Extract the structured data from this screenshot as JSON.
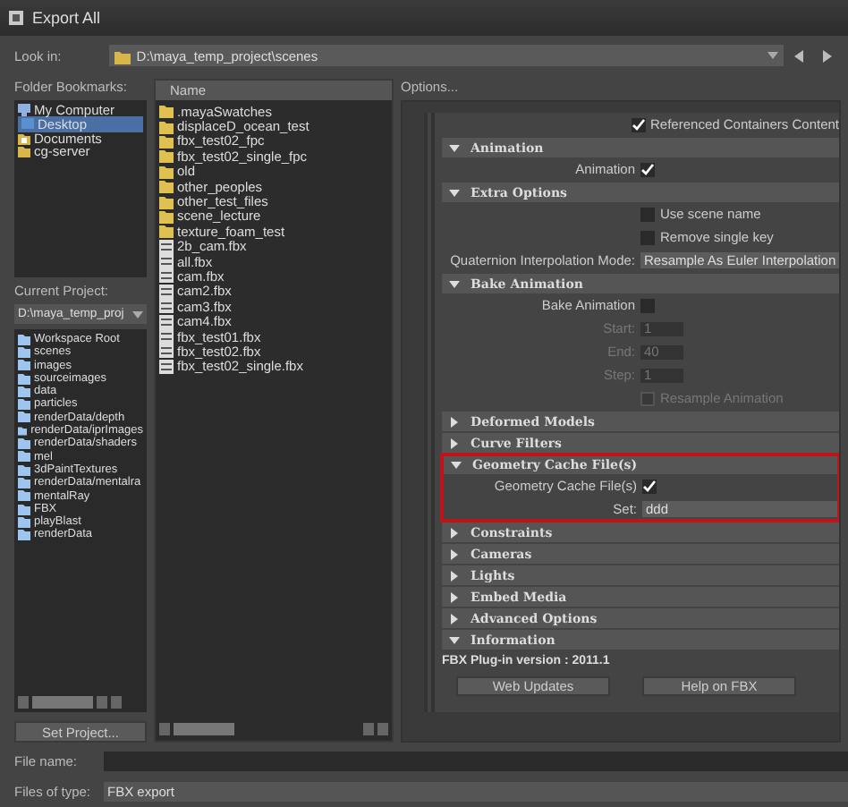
{
  "window": {
    "title": "Export All"
  },
  "look_in": {
    "label": "Look in:",
    "value": "D:\\maya_temp_project\\scenes"
  },
  "bookmarks": {
    "label": "Folder Bookmarks:",
    "items": [
      {
        "label": "My Computer",
        "kind": "computer",
        "selected": false
      },
      {
        "label": "Desktop",
        "kind": "desktop",
        "selected": true
      },
      {
        "label": "Documents",
        "kind": "documents",
        "selected": false
      },
      {
        "label": "cg-server",
        "kind": "folder",
        "selected": false
      }
    ]
  },
  "current_project": {
    "label": "Current Project:",
    "value": "D:\\maya_temp_proj",
    "items": [
      "Workspace Root",
      "scenes",
      "images",
      "sourceimages",
      "data",
      "particles",
      "renderData/depth",
      "renderData/iprImages",
      "renderData/shaders",
      "mel",
      "3dPaintTextures",
      "renderData/mentalra",
      "mentalRay",
      "FBX",
      "playBlast",
      "renderData"
    ],
    "button": "Set Project..."
  },
  "files": {
    "column": "Name",
    "items": [
      {
        "name": ".mayaSwatches",
        "kind": "folder"
      },
      {
        "name": "displaceD_ocean_test",
        "kind": "folder"
      },
      {
        "name": "fbx_test02_fpc",
        "kind": "folder"
      },
      {
        "name": "fbx_test02_single_fpc",
        "kind": "folder"
      },
      {
        "name": "old",
        "kind": "folder"
      },
      {
        "name": "other_peoples",
        "kind": "folder"
      },
      {
        "name": "other_test_files",
        "kind": "folder"
      },
      {
        "name": "scene_lecture",
        "kind": "folder"
      },
      {
        "name": "texture_foam_test",
        "kind": "folder"
      },
      {
        "name": "2b_cam.fbx",
        "kind": "file"
      },
      {
        "name": "all.fbx",
        "kind": "file"
      },
      {
        "name": "cam.fbx",
        "kind": "file"
      },
      {
        "name": "cam2.fbx",
        "kind": "file"
      },
      {
        "name": "cam3.fbx",
        "kind": "file"
      },
      {
        "name": "cam4.fbx",
        "kind": "file"
      },
      {
        "name": "fbx_test01.fbx",
        "kind": "file"
      },
      {
        "name": "fbx_test02.fbx",
        "kind": "file"
      },
      {
        "name": "fbx_test02_single.fbx",
        "kind": "file"
      }
    ]
  },
  "options": {
    "label": "Options...",
    "rows": [
      {
        "kind": "checkbox",
        "label": "Referenced Containers Content",
        "checked": true
      },
      {
        "kind": "section",
        "label": "Animation",
        "expanded": true,
        "highlighted": false,
        "rows": [
          {
            "kind": "labeled_checkbox",
            "label": "Animation",
            "checked": true
          }
        ]
      },
      {
        "kind": "section",
        "label": "Extra Options",
        "expanded": true,
        "highlighted": false,
        "rows": [
          {
            "kind": "checkbox",
            "label": "Use scene name",
            "checked": false
          },
          {
            "kind": "checkbox",
            "label": "Remove single key",
            "checked": false
          },
          {
            "kind": "select",
            "label": "Quaternion Interpolation Mode:",
            "value": "Resample As Euler Interpolation"
          }
        ]
      },
      {
        "kind": "section",
        "label": "Bake Animation",
        "expanded": true,
        "highlighted": false,
        "rows": [
          {
            "kind": "labeled_checkbox",
            "label": "Bake Animation",
            "checked": false
          },
          {
            "kind": "field",
            "label": "Start:",
            "value": "1",
            "disabled": true
          },
          {
            "kind": "field",
            "label": "End:",
            "value": "40",
            "disabled": true
          },
          {
            "kind": "field",
            "label": "Step:",
            "value": "1",
            "disabled": true
          },
          {
            "kind": "checkbox",
            "label": "Resample Animation",
            "checked": false,
            "disabled": true
          }
        ]
      },
      {
        "kind": "section",
        "label": "Deformed Models",
        "expanded": false,
        "highlighted": false
      },
      {
        "kind": "section",
        "label": "Curve Filters",
        "expanded": false,
        "highlighted": false
      },
      {
        "kind": "section",
        "label": "Geometry Cache File(s)",
        "expanded": true,
        "highlighted": true,
        "rows": [
          {
            "kind": "labeled_checkbox",
            "label": "Geometry Cache File(s)",
            "checked": true
          },
          {
            "kind": "wide",
            "label": "Set:",
            "value": "ddd"
          }
        ]
      },
      {
        "kind": "section",
        "label": "Constraints",
        "expanded": false,
        "highlighted": false
      },
      {
        "kind": "section",
        "label": "Cameras",
        "expanded": false,
        "highlighted": false
      },
      {
        "kind": "section",
        "label": "Lights",
        "expanded": false,
        "highlighted": false
      },
      {
        "kind": "section",
        "label": "Embed Media",
        "expanded": false,
        "highlighted": false
      },
      {
        "kind": "section",
        "label": "Advanced Options",
        "expanded": false,
        "highlighted": false
      },
      {
        "kind": "section",
        "label": "Information",
        "expanded": true,
        "highlighted": false,
        "rows": [
          {
            "kind": "info",
            "label": "FBX Plug-in version : 2011.1"
          },
          {
            "kind": "buttons",
            "buttons": [
              "Web Updates",
              "Help on FBX"
            ]
          }
        ]
      }
    ]
  },
  "file_name": {
    "label": "File name:"
  },
  "file_type": {
    "label": "Files of type:",
    "value": "FBX export"
  }
}
